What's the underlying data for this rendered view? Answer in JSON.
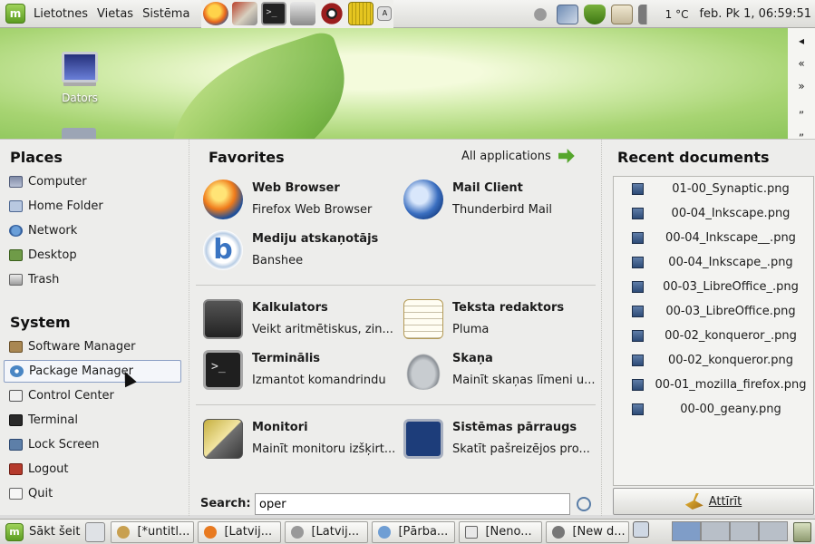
{
  "top_panel": {
    "menus": [
      "Lietotnes",
      "Vietas",
      "Sistēma"
    ],
    "temperature": "1 °C",
    "clock": "feb. Pk  1, 06:59:51"
  },
  "desktop": {
    "icon_label": "Dators"
  },
  "menu": {
    "places_title": "Places",
    "places": [
      "Computer",
      "Home Folder",
      "Network",
      "Desktop",
      "Trash"
    ],
    "system_title": "System",
    "system": [
      "Software Manager",
      "Package Manager",
      "Control Center",
      "Terminal",
      "Lock Screen",
      "Logout",
      "Quit"
    ],
    "favorites_title": "Favorites",
    "all_applications": "All applications",
    "apps": [
      {
        "name": "Web Browser",
        "desc": "Firefox Web Browser",
        "icon": "firefox-icon"
      },
      {
        "name": "Mail Client",
        "desc": "Thunderbird Mail",
        "icon": "thunderbird-icon"
      },
      {
        "name": "Mediju atskaņotājs",
        "desc": "Banshee",
        "icon": "banshee-icon"
      },
      {
        "name": "Kalkulators",
        "desc": "Veikt aritmētiskus, zin...",
        "icon": "calculator-icon"
      },
      {
        "name": "Teksta redaktors",
        "desc": "Pluma",
        "icon": "text-editor-icon"
      },
      {
        "name": "Terminālis",
        "desc": "Izmantot komandrindu",
        "icon": "terminal-icon"
      },
      {
        "name": "Skaņa",
        "desc": "Mainīt skaņas līmeni u...",
        "icon": "sound-icon"
      },
      {
        "name": "Monitori",
        "desc": "Mainīt monitoru izšķirt...",
        "icon": "monitor-icon"
      },
      {
        "name": "Sistēmas pārraugs",
        "desc": "Skatīt pašreizējos pro...",
        "icon": "system-monitor-icon"
      }
    ],
    "search_label": "Search:",
    "search_value": "oper",
    "recent_title": "Recent documents",
    "recent": [
      "01-00_Synaptic.png",
      "00-04_Inkscape.png",
      "00-04_Inkscape__.png",
      "00-04_Inkscape_.png",
      "00-03_LibreOffice_.png",
      "00-03_LibreOffice.png",
      "00-02_konqueror_.png",
      "00-02_konqueror.png",
      "00-01_mozilla_firefox.png",
      "00-00_geany.png"
    ],
    "clear_label": "Attīrīt"
  },
  "bottom_panel": {
    "start_label": "Sākt šeit",
    "tasks": [
      "[*untitl...",
      "[Latvij...",
      "[Latvij...",
      "[Pārba...",
      "[Neno...",
      "[New d..."
    ]
  }
}
